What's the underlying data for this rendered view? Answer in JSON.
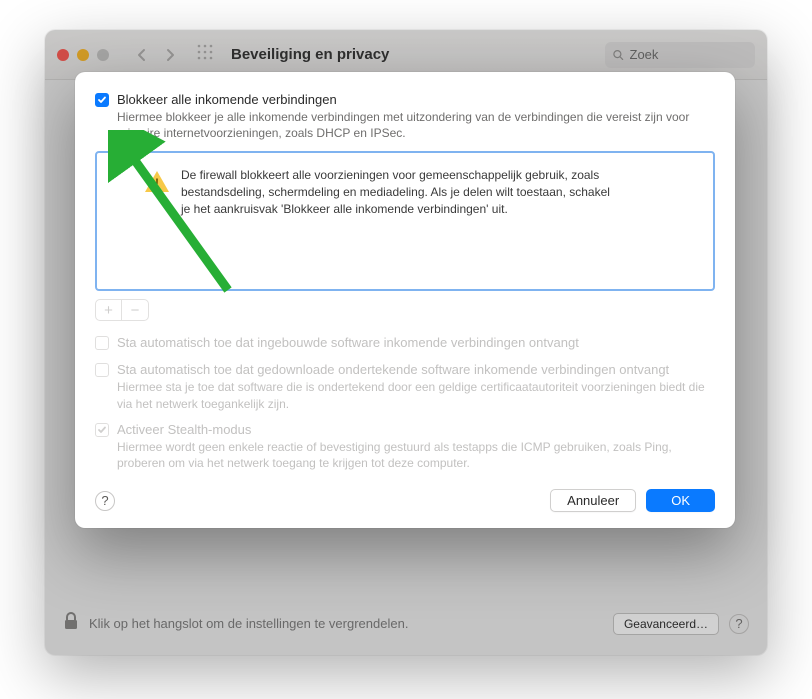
{
  "window": {
    "title": "Beveiliging en privacy",
    "search_placeholder": "Zoek",
    "lock_text": "Klik op het hangslot om de instellingen te vergrendelen.",
    "advanced_label": "Geavanceerd…"
  },
  "sheet": {
    "block_all": {
      "label": "Blokkeer alle inkomende verbindingen",
      "desc": "Hiermee blokkeer je alle inkomende verbindingen met uitzondering van de verbindingen die vereist zijn voor primaire internetvoorzieningen, zoals DHCP en IPSec."
    },
    "notice": "De firewall blokkeert alle voorzieningen voor gemeenschappelijk gebruik, zoals bestandsdeling, schermdeling en mediadeling. Als je delen wilt toestaan, schakel je het aankruisvak 'Blokkeer alle inkomende verbindingen' uit.",
    "builtin": {
      "label": "Sta automatisch toe dat ingebouwde software inkomende verbindingen ontvangt"
    },
    "signed": {
      "label": "Sta automatisch toe dat gedownloade ondertekende software inkomende verbindingen ontvangt",
      "desc": "Hiermee sta je toe dat software die is ondertekend door een geldige certificaatautoriteit voorzieningen biedt die via het netwerk toegankelijk zijn."
    },
    "stealth": {
      "label": "Activeer Stealth-modus",
      "desc": "Hiermee wordt geen enkele reactie of bevestiging gestuurd als testapps die ICMP gebruiken, zoals Ping, proberen om via het netwerk toegang te krijgen tot deze computer."
    },
    "help": "?",
    "cancel": "Annuleer",
    "ok": "OK"
  }
}
